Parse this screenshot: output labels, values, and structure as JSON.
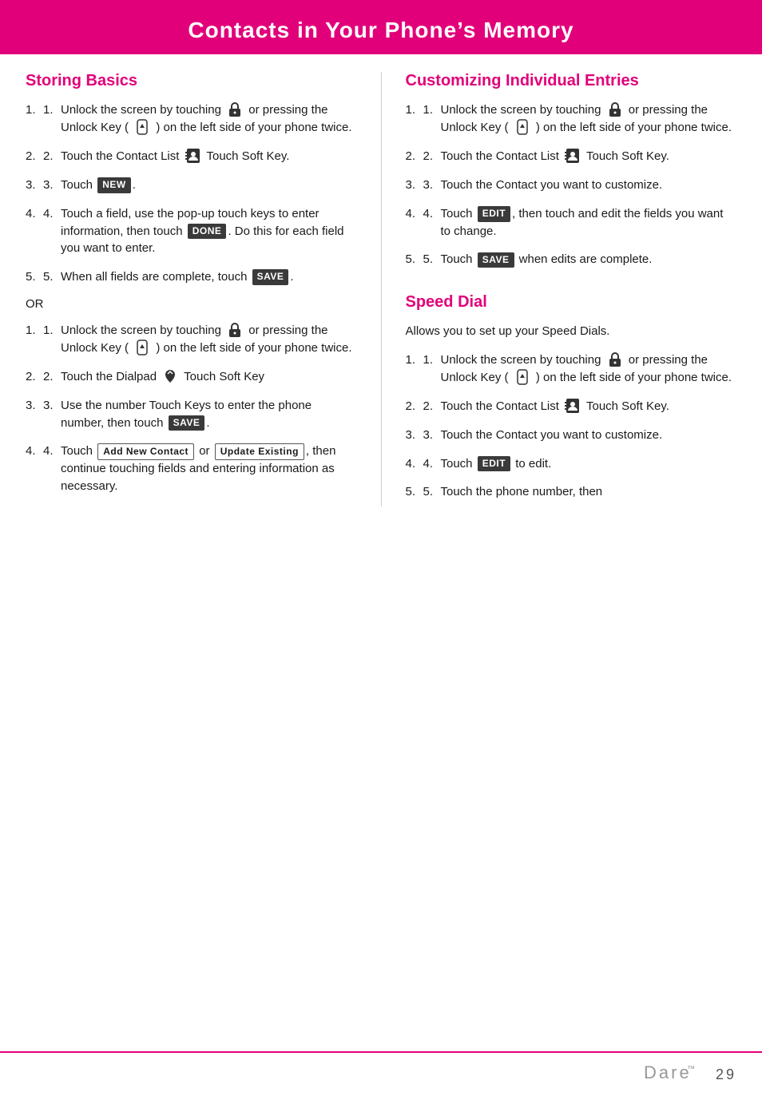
{
  "header": {
    "title": "Contacts in Your Phone’s Memory"
  },
  "left_col": {
    "section1": {
      "title": "Storing Basics",
      "items": [
        {
          "id": 1,
          "text_parts": [
            {
              "type": "text",
              "value": "Unlock the screen by touching "
            },
            {
              "type": "icon",
              "name": "lock-icon"
            },
            {
              "type": "text",
              "value": " or pressing the Unlock Key ( "
            },
            {
              "type": "icon",
              "name": "unlock-key-icon"
            },
            {
              "type": "text",
              "value": " ) on the left side of your phone twice."
            }
          ]
        },
        {
          "id": 2,
          "text_parts": [
            {
              "type": "text",
              "value": "Touch the Contact List "
            },
            {
              "type": "icon",
              "name": "contact-list-icon"
            },
            {
              "type": "text",
              "value": " Touch Soft Key."
            }
          ]
        },
        {
          "id": 3,
          "text_parts": [
            {
              "type": "text",
              "value": "Touch "
            },
            {
              "type": "btn",
              "value": "NEW"
            },
            {
              "type": "text",
              "value": "."
            }
          ]
        },
        {
          "id": 4,
          "text_parts": [
            {
              "type": "text",
              "value": "Touch a field, use the pop-up touch keys to enter information, then touch "
            },
            {
              "type": "btn",
              "value": "DONE"
            },
            {
              "type": "text",
              "value": ". Do this for each field you want to enter."
            }
          ]
        },
        {
          "id": 5,
          "text_parts": [
            {
              "type": "text",
              "value": "When all fields are complete, touch "
            },
            {
              "type": "btn",
              "value": "SAVE"
            },
            {
              "type": "text",
              "value": "."
            }
          ]
        }
      ]
    },
    "or_label": "OR",
    "section2": {
      "items": [
        {
          "id": 1,
          "text_parts": [
            {
              "type": "text",
              "value": "Unlock the screen by touching "
            },
            {
              "type": "icon",
              "name": "lock-icon"
            },
            {
              "type": "text",
              "value": " or pressing the Unlock Key ( "
            },
            {
              "type": "icon",
              "name": "unlock-key-icon"
            },
            {
              "type": "text",
              "value": " ) on the left side of your phone twice."
            }
          ]
        },
        {
          "id": 2,
          "text_parts": [
            {
              "type": "text",
              "value": "Touch the Dialpad "
            },
            {
              "type": "icon",
              "name": "dialpad-icon"
            },
            {
              "type": "text",
              "value": " Touch Soft Key"
            }
          ]
        },
        {
          "id": 3,
          "text_parts": [
            {
              "type": "text",
              "value": "Use the number Touch Keys to enter the phone number, then touch "
            },
            {
              "type": "btn",
              "value": "SAVE"
            },
            {
              "type": "text",
              "value": "."
            }
          ]
        },
        {
          "id": 4,
          "text_parts": [
            {
              "type": "text",
              "value": "Touch "
            },
            {
              "type": "btn-outline",
              "value": "Add New Contact"
            },
            {
              "type": "text",
              "value": " or "
            },
            {
              "type": "btn-outline",
              "value": "Update Existing"
            },
            {
              "type": "text",
              "value": ", then continue touching fields and entering information as necessary."
            }
          ]
        }
      ]
    }
  },
  "right_col": {
    "section1": {
      "title": "Customizing Individual Entries",
      "items": [
        {
          "id": 1,
          "text_parts": [
            {
              "type": "text",
              "value": "Unlock the screen by touching "
            },
            {
              "type": "icon",
              "name": "lock-icon"
            },
            {
              "type": "text",
              "value": " or pressing the Unlock Key ( "
            },
            {
              "type": "icon",
              "name": "unlock-key-icon"
            },
            {
              "type": "text",
              "value": " ) on the left side of your phone twice."
            }
          ]
        },
        {
          "id": 2,
          "text_parts": [
            {
              "type": "text",
              "value": "Touch the Contact List "
            },
            {
              "type": "icon",
              "name": "contact-list-icon"
            },
            {
              "type": "text",
              "value": " Touch Soft Key."
            }
          ]
        },
        {
          "id": 3,
          "text_parts": [
            {
              "type": "text",
              "value": "Touch the Contact you want to customize."
            }
          ]
        },
        {
          "id": 4,
          "text_parts": [
            {
              "type": "text",
              "value": "Touch "
            },
            {
              "type": "btn",
              "value": "EDIT"
            },
            {
              "type": "text",
              "value": ", then touch and edit the fields you want to change."
            }
          ]
        },
        {
          "id": 5,
          "text_parts": [
            {
              "type": "text",
              "value": "Touch "
            },
            {
              "type": "btn",
              "value": "SAVE"
            },
            {
              "type": "text",
              "value": " when edits are complete."
            }
          ]
        }
      ]
    },
    "section2": {
      "title": "Speed Dial",
      "intro": "Allows you to set up your Speed Dials.",
      "items": [
        {
          "id": 1,
          "text_parts": [
            {
              "type": "text",
              "value": "Unlock the screen by touching "
            },
            {
              "type": "icon",
              "name": "lock-icon"
            },
            {
              "type": "text",
              "value": " or pressing the Unlock Key ( "
            },
            {
              "type": "icon",
              "name": "unlock-key-icon"
            },
            {
              "type": "text",
              "value": " ) on the left side of your phone twice."
            }
          ]
        },
        {
          "id": 2,
          "text_parts": [
            {
              "type": "text",
              "value": "Touch the Contact List "
            },
            {
              "type": "icon",
              "name": "contact-list-icon"
            },
            {
              "type": "text",
              "value": " Touch Soft Key."
            }
          ]
        },
        {
          "id": 3,
          "text_parts": [
            {
              "type": "text",
              "value": "Touch the Contact you want to customize."
            }
          ]
        },
        {
          "id": 4,
          "text_parts": [
            {
              "type": "text",
              "value": "Touch "
            },
            {
              "type": "btn",
              "value": "EDIT"
            },
            {
              "type": "text",
              "value": " to edit."
            }
          ]
        },
        {
          "id": 5,
          "text_parts": [
            {
              "type": "text",
              "value": "Touch the phone number, then"
            }
          ]
        }
      ]
    }
  },
  "footer": {
    "logo": "Dare",
    "trademark": "™",
    "page_number": "29"
  }
}
